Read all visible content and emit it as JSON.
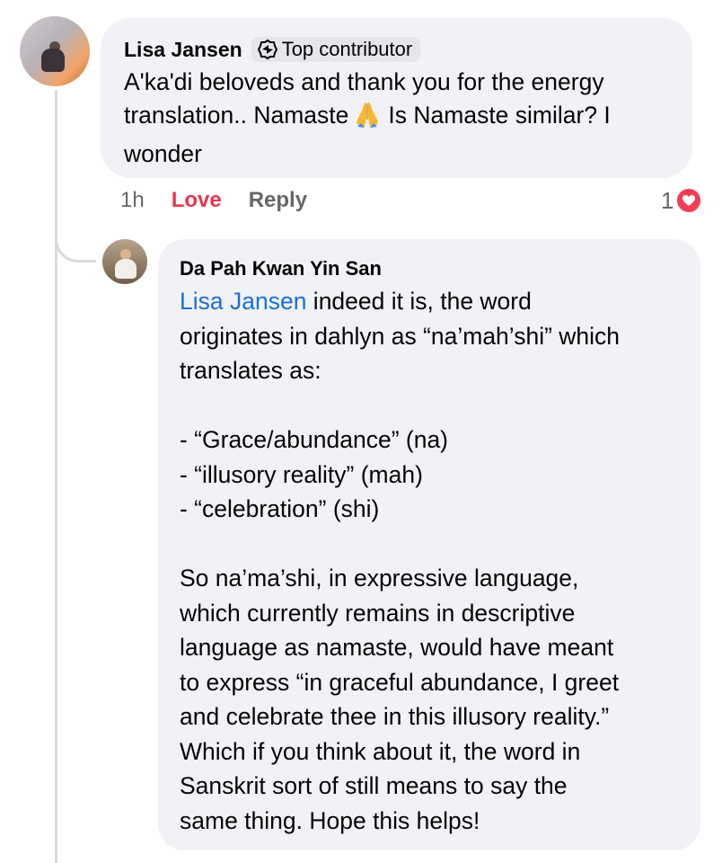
{
  "comment1": {
    "author": "Lisa Jansen",
    "badge": "Top contributor",
    "lines": [
      "A'ka'di beloveds and thank you for the energy",
      "translation.. Namaste",
      "Is Namaste similar? I",
      "wonder"
    ],
    "emoji": "folded-hands",
    "time": "1h",
    "love_label": "Love",
    "reply_label": "Reply",
    "reaction_count": "1",
    "reaction_type": "heart"
  },
  "reply1": {
    "author": "Da Pah Kwan Yin San",
    "mention": "Lisa Jansen",
    "first_line_rest": " indeed it is, the word",
    "lines": [
      "originates in dahlyn as “na’mah’shi” which",
      "translates as:",
      "",
      "- “Grace/abundance” (na)",
      "- “illusory reality” (mah)",
      "- “celebration” (shi)",
      "",
      "So na’ma’shi, in expressive language,",
      "which currently remains in descriptive",
      "language as namaste, would have meant",
      "to express “in graceful abundance, I greet",
      "and celebrate thee in this illusory reality.”",
      "Which if you think about it, the word in",
      "Sanskrit sort of still means to say the",
      "same thing. Hope this helps!"
    ]
  },
  "colors": {
    "bubble": "#f0f2f5",
    "love": "#e7364e",
    "mention": "#1b6fd6",
    "heart": "#f33e58",
    "meta": "#65676b"
  }
}
